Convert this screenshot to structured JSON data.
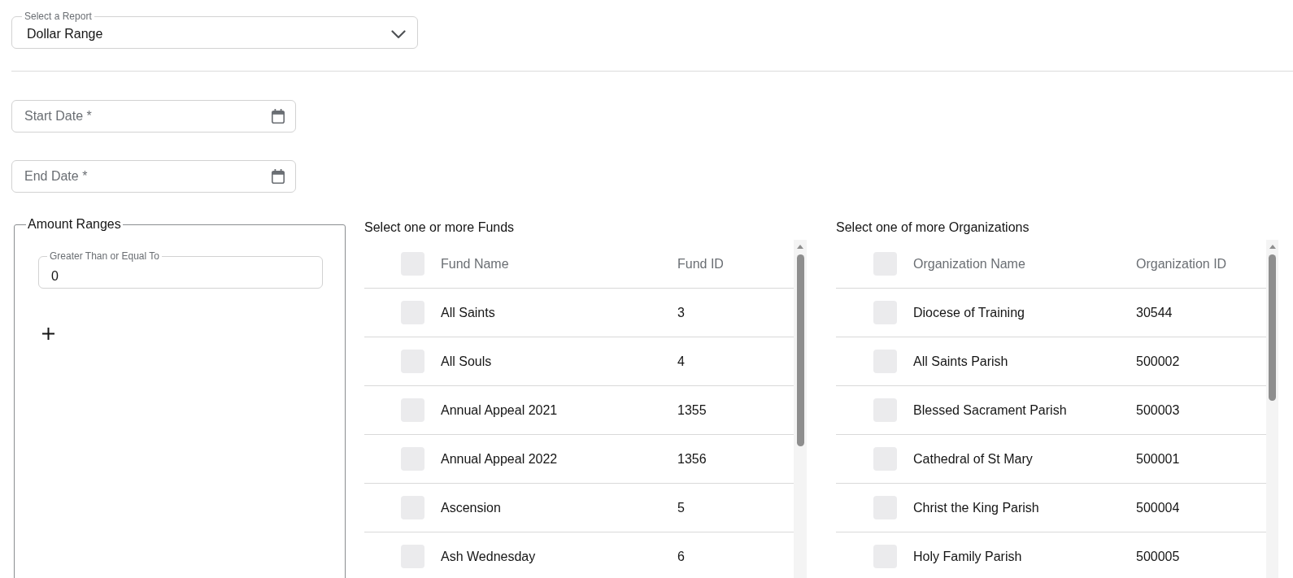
{
  "report_select": {
    "label": "Select a Report",
    "value": "Dollar Range"
  },
  "date_fields": [
    {
      "placeholder": "Start Date *"
    },
    {
      "placeholder": "End Date *"
    }
  ],
  "amount_ranges": {
    "legend": "Amount Ranges",
    "fields": [
      {
        "label": "Greater Than or Equal To",
        "value": "0"
      }
    ]
  },
  "funds": {
    "title": "Select one or more Funds",
    "all_checked": false,
    "columns": [
      "Fund Name",
      "Fund ID"
    ],
    "rows": [
      {
        "name": "All Saints",
        "id": "3",
        "checked": false
      },
      {
        "name": "All Souls",
        "id": "4",
        "checked": false
      },
      {
        "name": "Annual Appeal 2021",
        "id": "1355",
        "checked": false
      },
      {
        "name": "Annual Appeal 2022",
        "id": "1356",
        "checked": false
      },
      {
        "name": "Ascension",
        "id": "5",
        "checked": false
      },
      {
        "name": "Ash Wednesday",
        "id": "6",
        "checked": false
      }
    ]
  },
  "organizations": {
    "title": "Select one of more Organizations",
    "all_checked": false,
    "columns": [
      "Organization Name",
      "Organization ID"
    ],
    "rows": [
      {
        "name": "Diocese of Training",
        "id": "30544",
        "checked": false
      },
      {
        "name": "All Saints Parish",
        "id": "500002",
        "checked": false
      },
      {
        "name": "Blessed Sacrament Parish",
        "id": "500003",
        "checked": false
      },
      {
        "name": "Cathedral of St Mary",
        "id": "500001",
        "checked": false
      },
      {
        "name": "Christ the King Parish",
        "id": "500004",
        "checked": false
      },
      {
        "name": "Holy Family Parish",
        "id": "500005",
        "checked": false
      }
    ]
  }
}
